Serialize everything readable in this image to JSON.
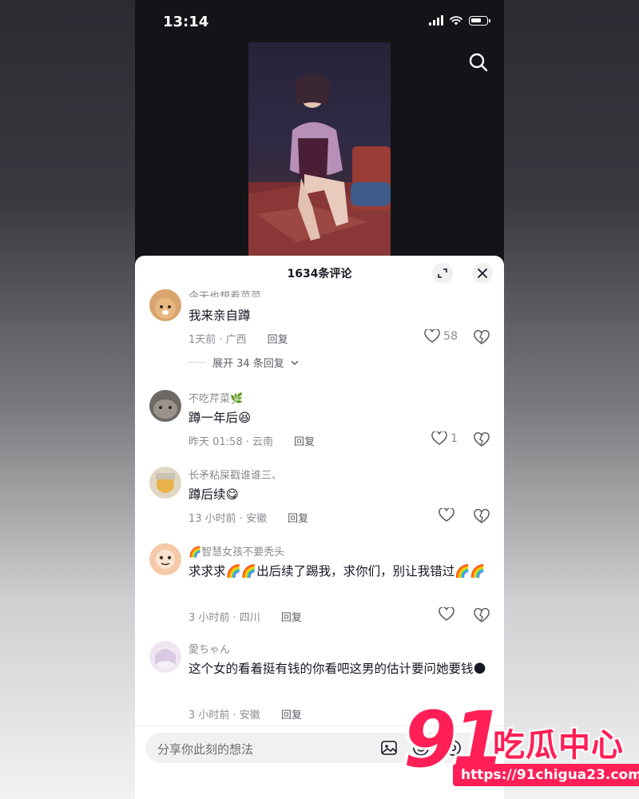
{
  "status_bar": {
    "time": "13:14"
  },
  "sheet": {
    "title": "1634条评论"
  },
  "comments": [
    {
      "username": "今天也想看菜菜",
      "text": "我来亲自蹲",
      "time": "1天前 · 广西",
      "reply": "回复",
      "likes": "58",
      "expand_replies": "展开 34 条回复"
    },
    {
      "username": "不吃芹菜🌿",
      "text": "蹲一年后😆",
      "time": "昨天 01:58 · 云南",
      "reply": "回复",
      "likes": "1"
    },
    {
      "username": "长矛粘屎戳谁谁三、",
      "text": "蹲后续😋",
      "time": "13 小时前 · 安徽",
      "reply": "回复",
      "likes": ""
    },
    {
      "username": "🌈智慧女孩不要秃头",
      "text": "求求求🌈🌈出后续了踢我，求你们，别让我错过🌈🌈",
      "time": "3 小时前 · 四川",
      "reply": "回复",
      "likes": ""
    },
    {
      "username": "愛ちゃん",
      "text": "这个女的看着挺有钱的你看吧这男的估计要问她要钱🌑",
      "time": "3 小时前 · 安徽",
      "reply": "回复",
      "likes": ""
    }
  ],
  "input": {
    "placeholder": "分享你此刻的想法"
  },
  "watermark": {
    "brand_number": "91",
    "brand_text": "吃瓜中心",
    "url": "https://91chigua23.com"
  },
  "colors": {
    "accent": "#ff1f56",
    "sheet_bg": "#ffffff",
    "text_primary": "#161823",
    "text_secondary": "#8a8b91"
  }
}
